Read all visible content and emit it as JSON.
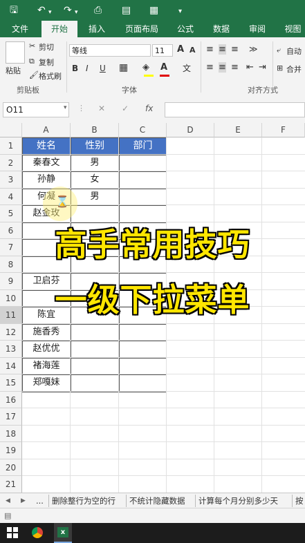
{
  "qat": {
    "save_icon": "save-icon",
    "undo_icon": "undo-icon",
    "redo_icon": "redo-icon",
    "preview_icon": "print-preview-icon",
    "form_icon": "form-icon",
    "more_icon": "chevron-down-icon"
  },
  "tabs": [
    "文件",
    "开始",
    "插入",
    "页面布局",
    "公式",
    "数据",
    "审阅",
    "视图"
  ],
  "active_tab": "开始",
  "ribbon": {
    "paste": "粘贴",
    "cut": "剪切",
    "copy": "复制",
    "format_painter": "格式刷",
    "clipboard_group": "剪贴板",
    "font_name": "等线",
    "font_size": "11",
    "grow": "A",
    "shrink": "A",
    "bold": "B",
    "italic": "I",
    "underline": "U",
    "font_color_letter": "A",
    "wen": "文",
    "font_group": "字体",
    "wrap": "自动",
    "merge": "合并",
    "align_group": "对齐方式"
  },
  "formula_bar": {
    "name_box": "O11",
    "fx": "fx",
    "cancel": "✕",
    "enter": "✓",
    "more": "⋮"
  },
  "columns": [
    "A",
    "B",
    "C",
    "D",
    "E",
    "F"
  ],
  "rows": [
    "1",
    "2",
    "3",
    "4",
    "5",
    "6",
    "7",
    "8",
    "9",
    "10",
    "11",
    "12",
    "13",
    "14",
    "15",
    "16",
    "17",
    "18",
    "19",
    "20",
    "21"
  ],
  "table": {
    "headers": [
      "姓名",
      "性别",
      "部门"
    ],
    "names": [
      "秦春文",
      "孙静",
      "何凝",
      "赵金玫",
      "",
      "",
      "",
      "卫启芬",
      "",
      "陈宜",
      "施香秀",
      "赵优优",
      "褚海莲",
      "郑嘎妹"
    ],
    "genders": [
      "男",
      "女",
      "男",
      "",
      "",
      "",
      "",
      "",
      "",
      "",
      "",
      "",
      "",
      ""
    ]
  },
  "overlay": {
    "line1": "高手常用技巧",
    "line2": "一级下拉菜单"
  },
  "sheet_tabs": [
    "...",
    "删除整行为空的行",
    "不统计隐藏数据",
    "计算每个月分别多少天",
    "按"
  ],
  "colors": {
    "excel_green": "#217346",
    "header_blue": "#4472c4",
    "overlay_yellow": "#ffe600"
  }
}
